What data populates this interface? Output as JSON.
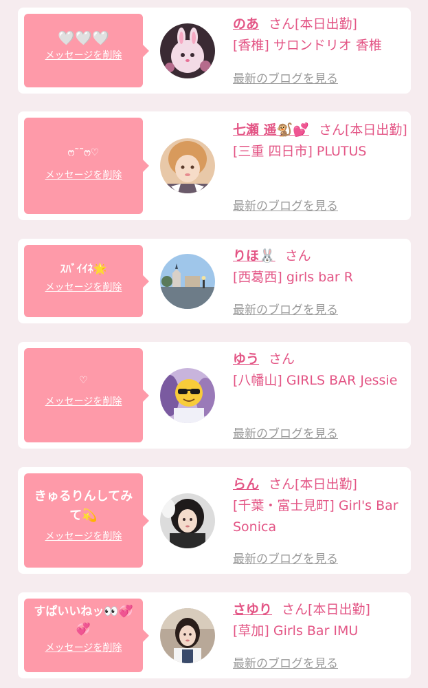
{
  "delete_label": "メッセージを削除",
  "blog_label": "最新のブログを見る",
  "san_label": "さん",
  "colors": {
    "bubble": "#fe9aa9",
    "accent": "#e35585",
    "link_gray": "#9a9a9a",
    "background": "#f6ecef"
  },
  "items": [
    {
      "message": "🤍🤍🤍",
      "name": "のあ",
      "attendance": "[本日出勤]",
      "shop": "[香椎] サロンドリオ 香椎",
      "avatar_icon": "bunny-avatar"
    },
    {
      "message": "ෆ˜˜ෆ♡",
      "name": "七瀬 遥🐒💕",
      "attendance": "[本日出勤]",
      "shop": "[三重 四日市] PLUTUS",
      "avatar_icon": "selfie-avatar"
    },
    {
      "message": "ｽﾊﾞｲｲﾈ🌟",
      "name": "りほ🐰",
      "attendance": "",
      "shop": "[西葛西] girls bar R",
      "avatar_icon": "scenery-avatar"
    },
    {
      "message": "♡",
      "name": "ゆう",
      "attendance": "",
      "shop": "[八幡山] GIRLS BAR Jessie",
      "avatar_icon": "sunglasses-emoji-avatar"
    },
    {
      "message": "きゅるりんしてみて💫",
      "name": "らん",
      "attendance": "[本日出勤]",
      "shop": "[千葉・富士見町] Girl's Bar Sonica",
      "avatar_icon": "portrait-avatar"
    },
    {
      "message": "すぱいいねッ👀💞💞",
      "name": "さゆり",
      "attendance": "[本日出勤]",
      "shop": "[草加] Girls Bar IMU",
      "avatar_icon": "portrait-avatar"
    }
  ]
}
